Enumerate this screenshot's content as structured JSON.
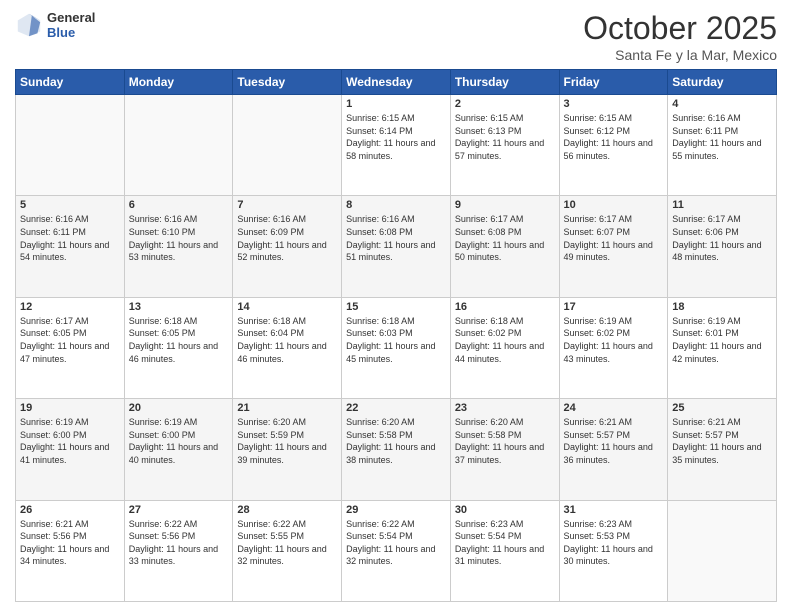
{
  "header": {
    "logo_general": "General",
    "logo_blue": "Blue",
    "month_title": "October 2025",
    "location": "Santa Fe y la Mar, Mexico"
  },
  "weekdays": [
    "Sunday",
    "Monday",
    "Tuesday",
    "Wednesday",
    "Thursday",
    "Friday",
    "Saturday"
  ],
  "weeks": [
    [
      {
        "day": "",
        "sunrise": "",
        "sunset": "",
        "daylight": ""
      },
      {
        "day": "",
        "sunrise": "",
        "sunset": "",
        "daylight": ""
      },
      {
        "day": "",
        "sunrise": "",
        "sunset": "",
        "daylight": ""
      },
      {
        "day": "1",
        "sunrise": "Sunrise: 6:15 AM",
        "sunset": "Sunset: 6:14 PM",
        "daylight": "Daylight: 11 hours and 58 minutes."
      },
      {
        "day": "2",
        "sunrise": "Sunrise: 6:15 AM",
        "sunset": "Sunset: 6:13 PM",
        "daylight": "Daylight: 11 hours and 57 minutes."
      },
      {
        "day": "3",
        "sunrise": "Sunrise: 6:15 AM",
        "sunset": "Sunset: 6:12 PM",
        "daylight": "Daylight: 11 hours and 56 minutes."
      },
      {
        "day": "4",
        "sunrise": "Sunrise: 6:16 AM",
        "sunset": "Sunset: 6:11 PM",
        "daylight": "Daylight: 11 hours and 55 minutes."
      }
    ],
    [
      {
        "day": "5",
        "sunrise": "Sunrise: 6:16 AM",
        "sunset": "Sunset: 6:11 PM",
        "daylight": "Daylight: 11 hours and 54 minutes."
      },
      {
        "day": "6",
        "sunrise": "Sunrise: 6:16 AM",
        "sunset": "Sunset: 6:10 PM",
        "daylight": "Daylight: 11 hours and 53 minutes."
      },
      {
        "day": "7",
        "sunrise": "Sunrise: 6:16 AM",
        "sunset": "Sunset: 6:09 PM",
        "daylight": "Daylight: 11 hours and 52 minutes."
      },
      {
        "day": "8",
        "sunrise": "Sunrise: 6:16 AM",
        "sunset": "Sunset: 6:08 PM",
        "daylight": "Daylight: 11 hours and 51 minutes."
      },
      {
        "day": "9",
        "sunrise": "Sunrise: 6:17 AM",
        "sunset": "Sunset: 6:08 PM",
        "daylight": "Daylight: 11 hours and 50 minutes."
      },
      {
        "day": "10",
        "sunrise": "Sunrise: 6:17 AM",
        "sunset": "Sunset: 6:07 PM",
        "daylight": "Daylight: 11 hours and 49 minutes."
      },
      {
        "day": "11",
        "sunrise": "Sunrise: 6:17 AM",
        "sunset": "Sunset: 6:06 PM",
        "daylight": "Daylight: 11 hours and 48 minutes."
      }
    ],
    [
      {
        "day": "12",
        "sunrise": "Sunrise: 6:17 AM",
        "sunset": "Sunset: 6:05 PM",
        "daylight": "Daylight: 11 hours and 47 minutes."
      },
      {
        "day": "13",
        "sunrise": "Sunrise: 6:18 AM",
        "sunset": "Sunset: 6:05 PM",
        "daylight": "Daylight: 11 hours and 46 minutes."
      },
      {
        "day": "14",
        "sunrise": "Sunrise: 6:18 AM",
        "sunset": "Sunset: 6:04 PM",
        "daylight": "Daylight: 11 hours and 46 minutes."
      },
      {
        "day": "15",
        "sunrise": "Sunrise: 6:18 AM",
        "sunset": "Sunset: 6:03 PM",
        "daylight": "Daylight: 11 hours and 45 minutes."
      },
      {
        "day": "16",
        "sunrise": "Sunrise: 6:18 AM",
        "sunset": "Sunset: 6:02 PM",
        "daylight": "Daylight: 11 hours and 44 minutes."
      },
      {
        "day": "17",
        "sunrise": "Sunrise: 6:19 AM",
        "sunset": "Sunset: 6:02 PM",
        "daylight": "Daylight: 11 hours and 43 minutes."
      },
      {
        "day": "18",
        "sunrise": "Sunrise: 6:19 AM",
        "sunset": "Sunset: 6:01 PM",
        "daylight": "Daylight: 11 hours and 42 minutes."
      }
    ],
    [
      {
        "day": "19",
        "sunrise": "Sunrise: 6:19 AM",
        "sunset": "Sunset: 6:00 PM",
        "daylight": "Daylight: 11 hours and 41 minutes."
      },
      {
        "day": "20",
        "sunrise": "Sunrise: 6:19 AM",
        "sunset": "Sunset: 6:00 PM",
        "daylight": "Daylight: 11 hours and 40 minutes."
      },
      {
        "day": "21",
        "sunrise": "Sunrise: 6:20 AM",
        "sunset": "Sunset: 5:59 PM",
        "daylight": "Daylight: 11 hours and 39 minutes."
      },
      {
        "day": "22",
        "sunrise": "Sunrise: 6:20 AM",
        "sunset": "Sunset: 5:58 PM",
        "daylight": "Daylight: 11 hours and 38 minutes."
      },
      {
        "day": "23",
        "sunrise": "Sunrise: 6:20 AM",
        "sunset": "Sunset: 5:58 PM",
        "daylight": "Daylight: 11 hours and 37 minutes."
      },
      {
        "day": "24",
        "sunrise": "Sunrise: 6:21 AM",
        "sunset": "Sunset: 5:57 PM",
        "daylight": "Daylight: 11 hours and 36 minutes."
      },
      {
        "day": "25",
        "sunrise": "Sunrise: 6:21 AM",
        "sunset": "Sunset: 5:57 PM",
        "daylight": "Daylight: 11 hours and 35 minutes."
      }
    ],
    [
      {
        "day": "26",
        "sunrise": "Sunrise: 6:21 AM",
        "sunset": "Sunset: 5:56 PM",
        "daylight": "Daylight: 11 hours and 34 minutes."
      },
      {
        "day": "27",
        "sunrise": "Sunrise: 6:22 AM",
        "sunset": "Sunset: 5:56 PM",
        "daylight": "Daylight: 11 hours and 33 minutes."
      },
      {
        "day": "28",
        "sunrise": "Sunrise: 6:22 AM",
        "sunset": "Sunset: 5:55 PM",
        "daylight": "Daylight: 11 hours and 32 minutes."
      },
      {
        "day": "29",
        "sunrise": "Sunrise: 6:22 AM",
        "sunset": "Sunset: 5:54 PM",
        "daylight": "Daylight: 11 hours and 32 minutes."
      },
      {
        "day": "30",
        "sunrise": "Sunrise: 6:23 AM",
        "sunset": "Sunset: 5:54 PM",
        "daylight": "Daylight: 11 hours and 31 minutes."
      },
      {
        "day": "31",
        "sunrise": "Sunrise: 6:23 AM",
        "sunset": "Sunset: 5:53 PM",
        "daylight": "Daylight: 11 hours and 30 minutes."
      },
      {
        "day": "",
        "sunrise": "",
        "sunset": "",
        "daylight": ""
      }
    ]
  ]
}
